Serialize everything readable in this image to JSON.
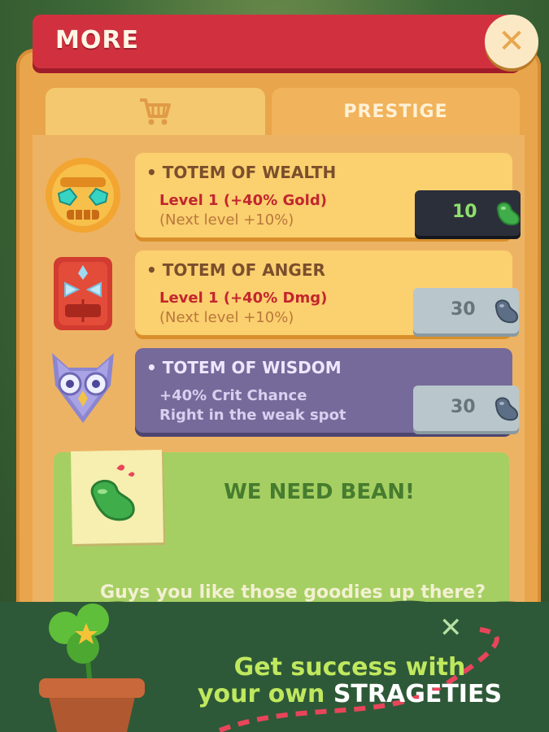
{
  "header": {
    "title": "MORE"
  },
  "tabs": [
    {
      "label": "",
      "icon": "shopping-cart-icon"
    },
    {
      "label": "PRESTIGE"
    }
  ],
  "items": [
    {
      "title": "• TOTEM OF WEALTH",
      "line1": "Level 1 (+40% Gold)",
      "line2": "(Next level +10%)",
      "cost": "10",
      "state": "active"
    },
    {
      "title": "• TOTEM OF ANGER",
      "line1": "Level 1 (+40% Dmg)",
      "line2": "(Next level +10%)",
      "cost": "30",
      "state": "disabled"
    },
    {
      "title": "• TOTEM OF WISDOM",
      "line1": "+40% Crit Chance",
      "line2": "Right in the weak spot",
      "cost": "30",
      "state": "disabled"
    }
  ],
  "notice": {
    "title": "WE NEED BEAN!",
    "text": "Guys you like those goodies up there?"
  },
  "promo": {
    "line1": "Get success with",
    "line2_prefix": "your own ",
    "line2_highlight": "STRAGETIES"
  },
  "colors": {
    "header": "#d1313f",
    "panel": "#e9a54b",
    "bean_green": "#3fae4a",
    "bean_gray": "#5d6f86"
  }
}
